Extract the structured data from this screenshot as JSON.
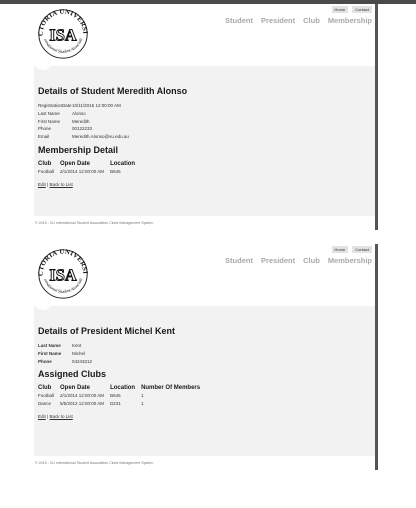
{
  "logo": {
    "top_text": "VICTORIA UNIVERSITY",
    "main_text": "ISA",
    "bottom_text": "International Student Association"
  },
  "nav": {
    "home": "Home",
    "contact": "Contact",
    "student": "Student",
    "president": "President",
    "club": "Club",
    "membership": "Membership"
  },
  "page1": {
    "title": "Details of Student Meredith Alonso",
    "fields": [
      {
        "label": "RegistrationDate",
        "value": "10/11/2015 12:00:00 AM"
      },
      {
        "label": "Last Name",
        "value": "Alonso"
      },
      {
        "label": "First Name",
        "value": "Meredith"
      },
      {
        "label": "Phone",
        "value": "00122233"
      },
      {
        "label": "Email",
        "value": "Meredith.Alonso@vu.edu.au"
      }
    ],
    "section_title": "Membership Detail",
    "table": {
      "headers": [
        "Club",
        "Open Date",
        "Location"
      ],
      "rows": [
        [
          "Football",
          "2/1/2014 12:00:00 AM",
          "B645"
        ]
      ]
    },
    "edit": "Edit",
    "separator": "|",
    "back": "Back to List"
  },
  "page2": {
    "title": "Details of President Michel Kent",
    "fields": [
      {
        "label": "Last Name",
        "value": "Kent"
      },
      {
        "label": "First Name",
        "value": "Michel"
      },
      {
        "label": "Phone",
        "value": "04243212"
      }
    ],
    "section_title": "Assigned Clubs",
    "table": {
      "headers": [
        "Club",
        "Open Date",
        "Location",
        "Number Of Members"
      ],
      "rows": [
        [
          "Football",
          "2/1/2014 12:00:00 AM",
          "B645",
          "1"
        ],
        [
          "Dance",
          "5/5/2012 12:00:00 AM",
          "D231",
          "1"
        ]
      ]
    },
    "edit": "Edit",
    "separator": "|",
    "back": "Back to List"
  },
  "footer": {
    "text": "© 2015 - VU International Student Association Clubs Management System"
  }
}
